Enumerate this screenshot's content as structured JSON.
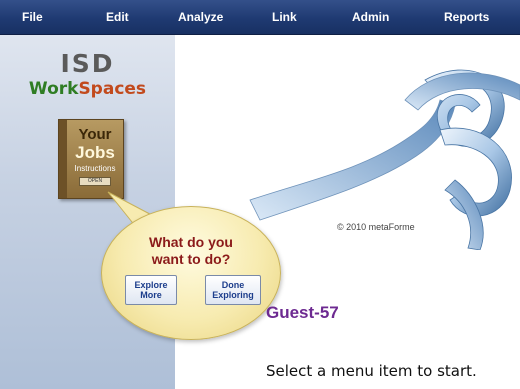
{
  "menu": {
    "items": [
      {
        "label": "File"
      },
      {
        "label": "Edit"
      },
      {
        "label": "Analyze"
      },
      {
        "label": "Link"
      },
      {
        "label": "Admin"
      },
      {
        "label": "Reports"
      }
    ]
  },
  "sidebar": {
    "logo_line1": "ISD",
    "logo_work": "Work",
    "logo_spaces": "Spaces",
    "book": {
      "line1": "Your",
      "line2": "Jobs",
      "line3": "Instructions",
      "line4": "OPEN"
    }
  },
  "bubble": {
    "question_line1": "What do you",
    "question_line2": "want to do?",
    "explore_line1": "Explore",
    "explore_line2": "More",
    "done_line1": "Done",
    "done_line2": "Exploring"
  },
  "main": {
    "copyright": "© 2010 metaForme",
    "user": "Guest-57",
    "prompt": "Select a menu item to start."
  },
  "colors": {
    "menubar": "#1f3a72",
    "sidebar": "#c7d2e3",
    "bubble": "#f7ebb0",
    "question_text": "#8b1a1a",
    "user_text": "#6d2a91",
    "ribbon_light": "#b8d2ec",
    "ribbon_dark": "#3d6c9e"
  }
}
